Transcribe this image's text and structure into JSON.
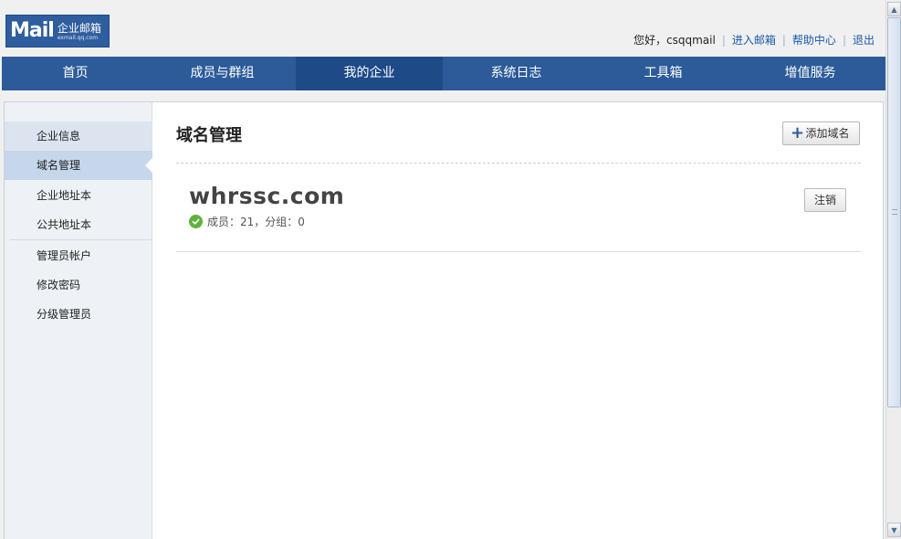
{
  "logo": {
    "main": "Mail",
    "cn": "企业邮箱",
    "url": "exmail.qq.com"
  },
  "toplinks": {
    "greeting": "您好，csqqmail",
    "enter_mail": "进入邮箱",
    "help": "帮助中心",
    "logout": "退出"
  },
  "nav": {
    "items": [
      "首页",
      "成员与群组",
      "我的企业",
      "系统日志",
      "工具箱",
      "增值服务"
    ],
    "active_index": 2
  },
  "sidebar": {
    "items": [
      "企业信息",
      "域名管理",
      "企业地址本",
      "公共地址本",
      "管理员帐户",
      "修改密码",
      "分级管理员"
    ]
  },
  "main": {
    "title": "域名管理",
    "add_button": "添加域名",
    "domain": {
      "name": "whrssc.com",
      "meta": "成员：21，分组：0",
      "cancel_button": "注销"
    }
  },
  "icons": {
    "add": "plus-icon",
    "status": "check-circle-icon",
    "scroll_up": "arrow-up-icon",
    "scroll_down": "arrow-down-icon"
  },
  "colors": {
    "nav_bg": "#2d5b9a",
    "nav_active": "#1e4a87",
    "link": "#1d5aa8",
    "success": "#5fb33c"
  }
}
